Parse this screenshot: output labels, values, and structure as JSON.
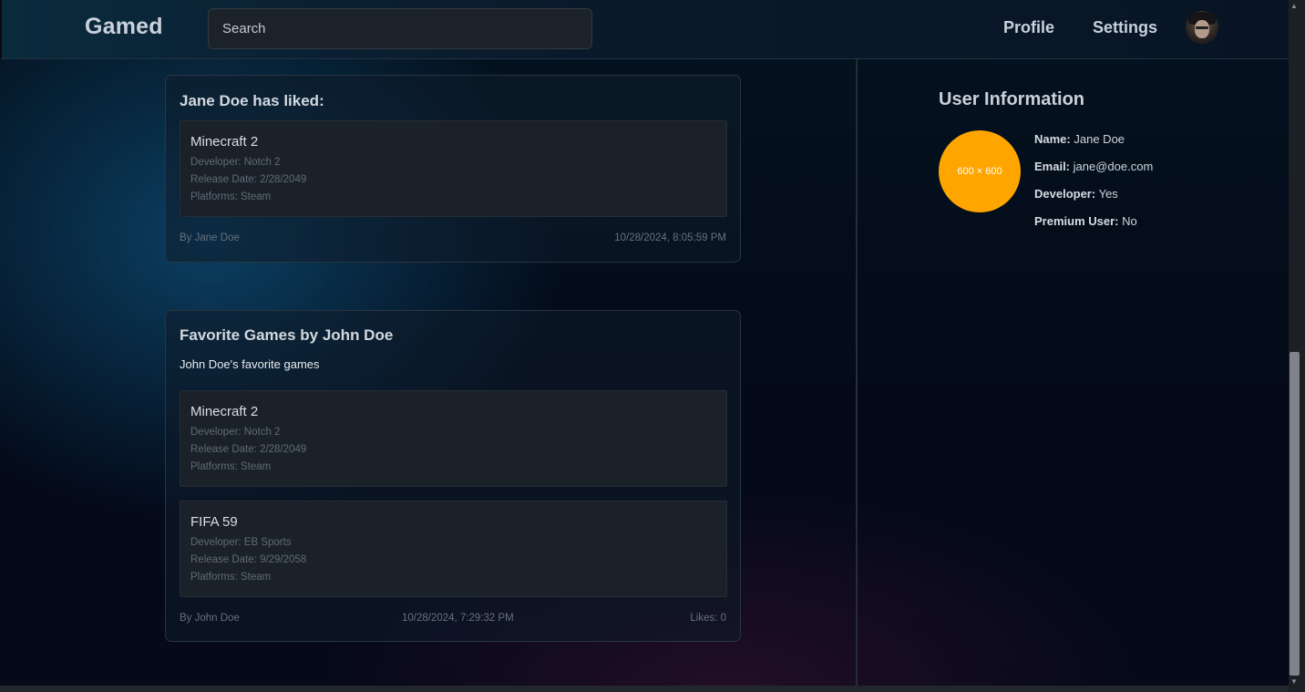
{
  "header": {
    "logo": "Gamed",
    "search_placeholder": "Search",
    "nav": {
      "profile": "Profile",
      "settings": "Settings"
    }
  },
  "feed": [
    {
      "title": "Jane Doe has liked:",
      "games": [
        {
          "title": "Minecraft 2",
          "developer": "Developer: Notch 2",
          "release": "Release Date: 2/28/2049",
          "platforms": "Platforms: Steam"
        }
      ],
      "author": "By Jane Doe",
      "timestamp": "10/28/2024, 8:05:59 PM"
    },
    {
      "title": "Favorite Games by John Doe",
      "description": "John Doe's favorite games",
      "games": [
        {
          "title": "Minecraft 2",
          "developer": "Developer: Notch 2",
          "release": "Release Date: 2/28/2049",
          "platforms": "Platforms: Steam"
        },
        {
          "title": "FIFA 59",
          "developer": "Developer: EB Sports",
          "release": "Release Date: 9/29/2058",
          "platforms": "Platforms: Steam"
        }
      ],
      "author": "By John Doe",
      "timestamp": "10/28/2024, 7:29:32 PM",
      "likes": "Likes: 0"
    }
  ],
  "user_info": {
    "title": "User Information",
    "image_placeholder": "600 × 600",
    "name_label": "Name:",
    "name_value": "Jane Doe",
    "email_label": "Email:",
    "email_value": "jane@doe.com",
    "developer_label": "Developer:",
    "developer_value": "Yes",
    "premium_label": "Premium User:",
    "premium_value": "No"
  },
  "colors": {
    "placeholder_bg": "#ffa500",
    "card_border": "#2a3541",
    "game_bg": "#1a2129"
  },
  "icons": {
    "scroll_up": "triangle-up",
    "scroll_down": "triangle-down"
  }
}
